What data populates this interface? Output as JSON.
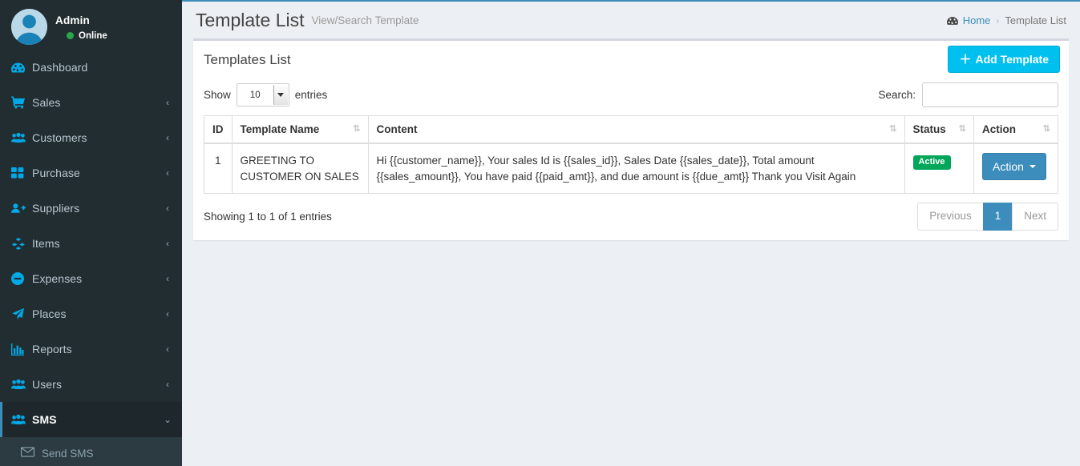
{
  "sidebar": {
    "user": {
      "name": "Admin",
      "status": "Online",
      "status_color": "#2ba84a",
      "avatar_icon": "user-avatar-icon"
    },
    "items": [
      {
        "label": "Dashboard",
        "icon": "dashboard-icon",
        "arrow": "",
        "active": false
      },
      {
        "label": "Sales",
        "icon": "shopping-cart-icon",
        "arrow": "‹",
        "active": false
      },
      {
        "label": "Customers",
        "icon": "users-group-icon",
        "arrow": "‹",
        "active": false
      },
      {
        "label": "Purchase",
        "icon": "grid-squares-icon",
        "arrow": "‹",
        "active": false
      },
      {
        "label": "Suppliers",
        "icon": "user-plus-icon",
        "arrow": "‹",
        "active": false
      },
      {
        "label": "Items",
        "icon": "cubes-icon",
        "arrow": "‹",
        "active": false
      },
      {
        "label": "Expenses",
        "icon": "minus-circle-icon",
        "arrow": "‹",
        "active": false
      },
      {
        "label": "Places",
        "icon": "paper-plane-icon",
        "arrow": "‹",
        "active": false
      },
      {
        "label": "Reports",
        "icon": "bar-chart-icon",
        "arrow": "‹",
        "active": false
      },
      {
        "label": "Users",
        "icon": "users-group-icon",
        "arrow": "‹",
        "active": false
      },
      {
        "label": "SMS",
        "icon": "users-group-icon",
        "arrow": "⌄",
        "active": true
      }
    ],
    "submenu": [
      {
        "label": "Send SMS",
        "icon": "envelope-icon"
      }
    ]
  },
  "header": {
    "title": "Template List",
    "subtitle": "View/Search Template",
    "breadcrumb": {
      "home_icon": "dashboard-icon",
      "home": "Home",
      "separator": "›",
      "current": "Template List"
    }
  },
  "box": {
    "title": "Templates List",
    "add_button": {
      "plus": "＋",
      "label": "Add Template"
    }
  },
  "datatable": {
    "length_label_before": "Show",
    "length_value": "10",
    "length_label_after": "entries",
    "search_label": "Search:",
    "search_value": "",
    "search_placeholder": "",
    "columns": [
      {
        "label": "ID",
        "sortable": false
      },
      {
        "label": "Template Name",
        "sortable": true
      },
      {
        "label": "Content",
        "sortable": true
      },
      {
        "label": "Status",
        "sortable": true
      },
      {
        "label": "Action",
        "sortable": true
      }
    ],
    "sort_glyph": "⇅",
    "rows": [
      {
        "id": "1",
        "name": "GREETING TO CUSTOMER ON SALES",
        "content": "Hi {{customer_name}}, Your sales Id is {{sales_id}}, Sales Date {{sales_date}}, Total amount {{sales_amount}}, You have paid {{paid_amt}}, and due amount is {{due_amt}} Thank you Visit Again",
        "status": "Active",
        "action_label": "Action"
      }
    ],
    "info": "Showing 1 to 1 of 1 entries",
    "pagination": {
      "previous": "Previous",
      "page_1": "1",
      "next": "Next"
    }
  },
  "colors": {
    "sidebar_bg": "#222d32",
    "sidebar_active_bg": "#1e282c",
    "sidebar_submenu_bg": "#2c3b41",
    "accent_blue": "#3c8dbc",
    "icon_blue": "#00a9e6",
    "add_button_bg": "#00c0ef",
    "status_green": "#00a65a",
    "page_bg": "#ecf0f5"
  }
}
